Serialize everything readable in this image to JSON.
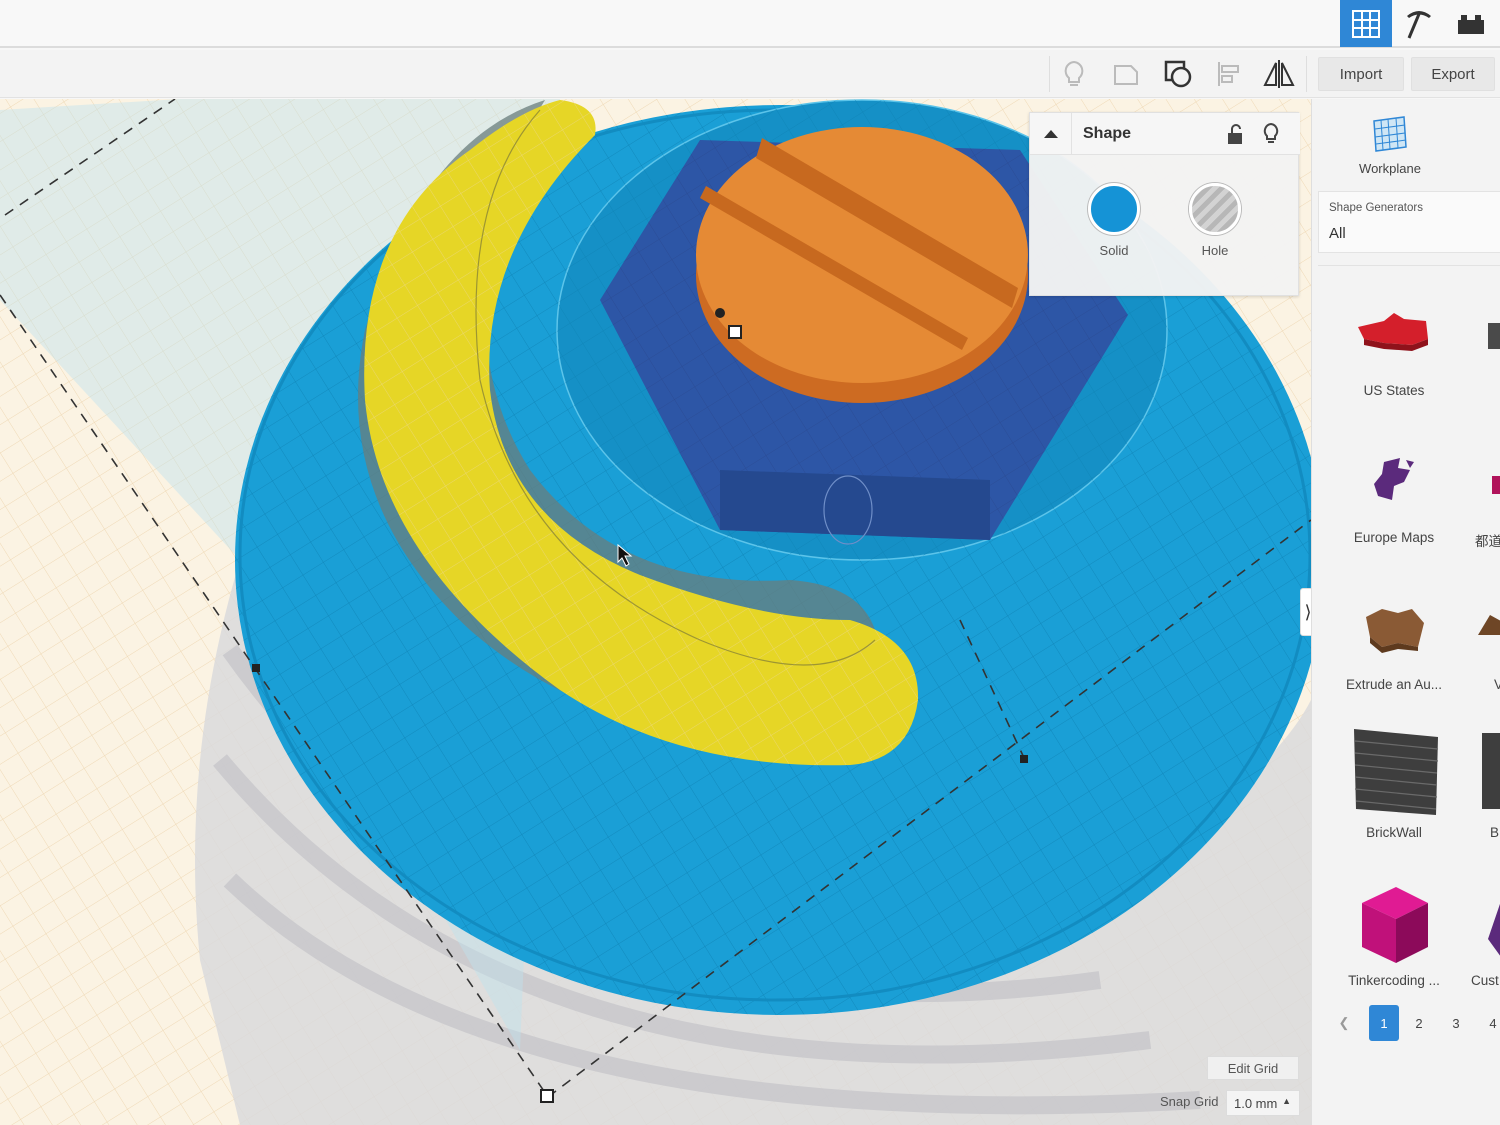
{
  "toolbar": {
    "import_label": "Import",
    "export_label": "Export"
  },
  "inspector": {
    "title": "Shape",
    "solid_label": "Solid",
    "hole_label": "Hole",
    "solid_color": "#1593d6"
  },
  "panel": {
    "workplane_label": "Workplane",
    "generators_title": "Shape Generators",
    "generators_value": "All",
    "items": [
      {
        "label": "US States",
        "color": "#d41f2b",
        "icon": "us-states-shape-icon"
      },
      {
        "label": "Europe Maps",
        "color": "#5b2a7c",
        "icon": "europe-map-shape-icon"
      },
      {
        "label": "Extrude an Au...",
        "color": "#8a5a35",
        "icon": "extrude-shape-icon"
      },
      {
        "label": "BrickWall",
        "color": "#3e3e3e",
        "icon": "brickwall-shape-icon"
      },
      {
        "label": "Tinkercoding ...",
        "color": "#c0117a",
        "icon": "tinkercoding-shape-icon"
      }
    ],
    "partial_items": [
      {
        "label": ""
      },
      {
        "label": "都道"
      },
      {
        "label": "V"
      },
      {
        "label": "B"
      },
      {
        "label": "Cust"
      }
    ],
    "pages": [
      "1",
      "2",
      "3",
      "4"
    ],
    "current_page": "1"
  },
  "grid": {
    "edit_label": "Edit Grid",
    "snap_label": "Snap Grid",
    "snap_value": "1.0 mm"
  },
  "colors": {
    "accent": "#2f87d6",
    "base_blue": "#1a9fd6",
    "hex_nut": "#3157a8",
    "screw_head": "#e58a35",
    "banana": "#e6d626"
  }
}
